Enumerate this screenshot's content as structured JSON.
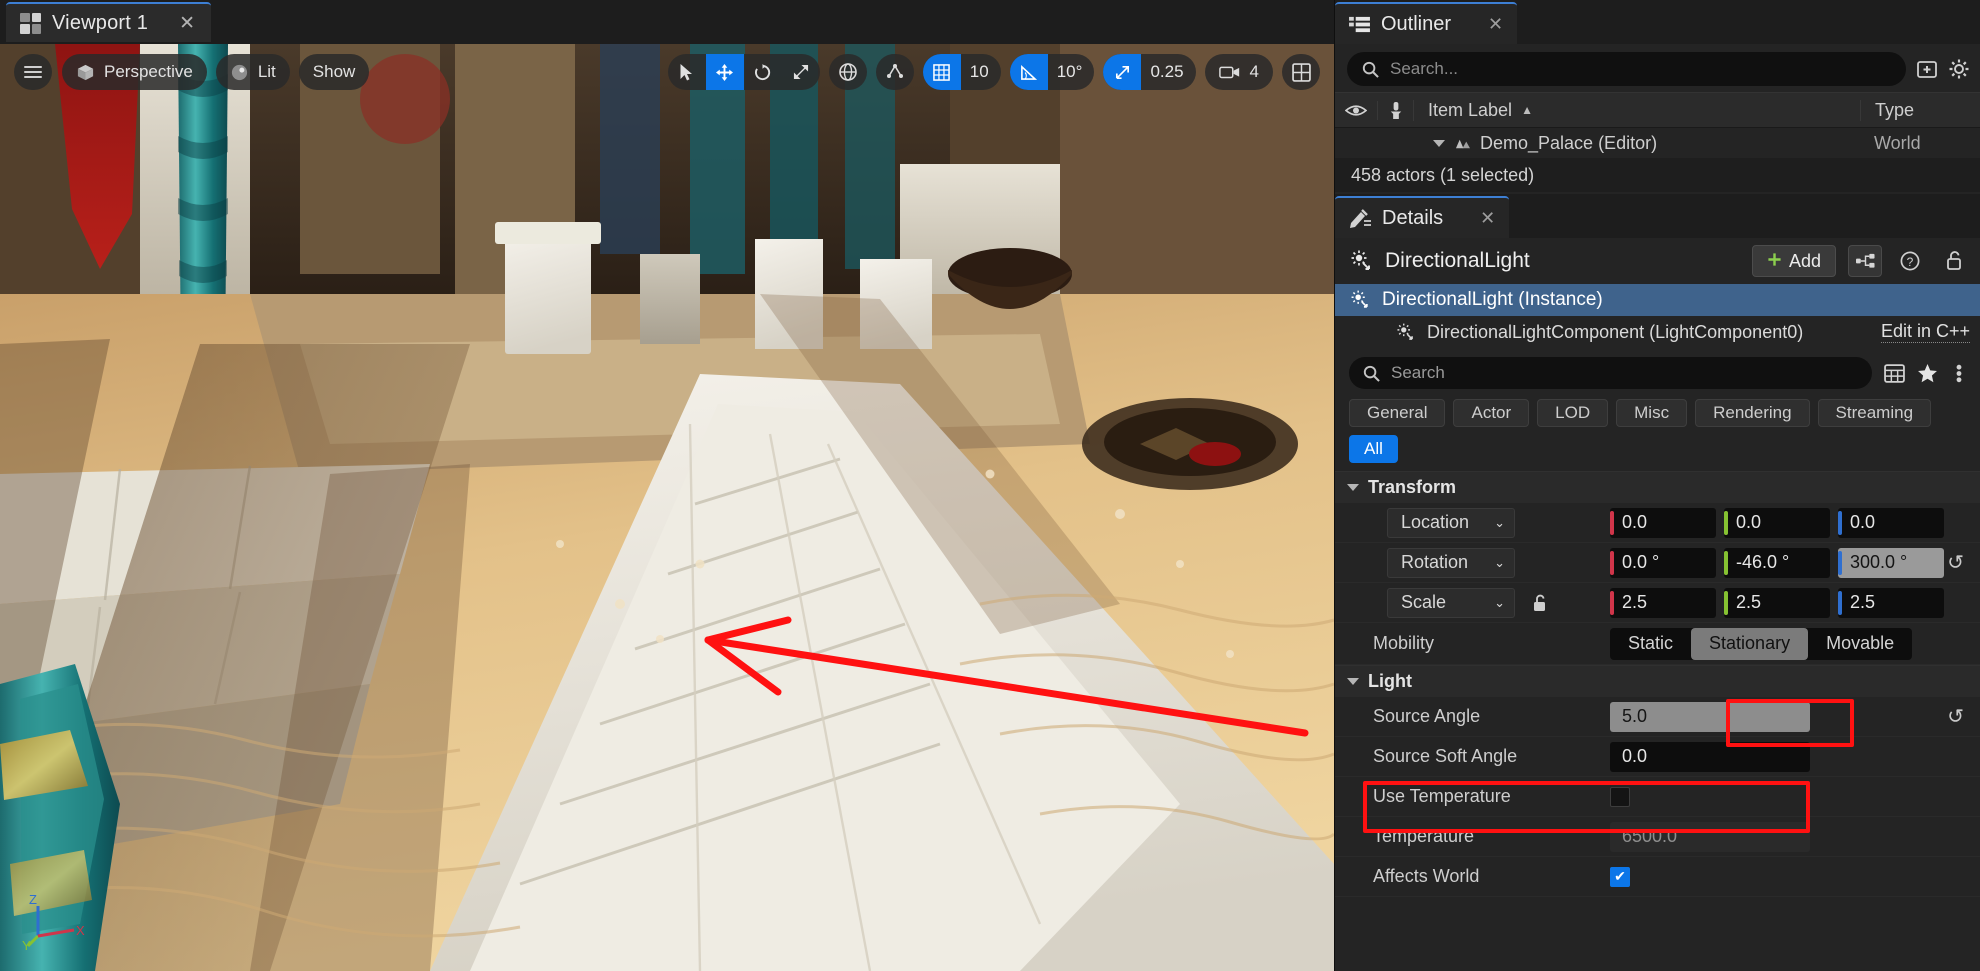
{
  "viewport": {
    "tab_label": "Viewport 1",
    "tab_close": "✕",
    "menu_icon": "hamburger-icon",
    "camera_mode": "Perspective",
    "view_mode": "Lit",
    "show_menu": "Show",
    "transform_tools": [
      "select-icon",
      "move-icon",
      "rotate-icon",
      "scale-icon"
    ],
    "coord_space": "globe-icon",
    "surface_snap": "surface-snap-icon",
    "grid_snap_value": "10",
    "angle_snap_value": "10°",
    "scale_snap_value": "0.25",
    "camera_speed_value": "4",
    "layout_icon": "viewport-layout-icon",
    "axis_labels": [
      "Z",
      "Y",
      "X"
    ]
  },
  "outliner": {
    "tab_label": "Outliner",
    "tab_close": "✕",
    "search_placeholder": "Search...",
    "columns": {
      "label": "Item Label",
      "type": "Type"
    },
    "sort_indicator": "▲",
    "rows": [
      {
        "label": "Demo_Palace (Editor)",
        "type": "World"
      }
    ],
    "status": "458 actors (1 selected)"
  },
  "details": {
    "tab_label": "Details",
    "tab_close": "✕",
    "header_title": "DirectionalLight",
    "header_icon": "directional-light-icon",
    "add_label": "Add",
    "components": [
      {
        "label": "DirectionalLight (Instance)",
        "selected": true
      },
      {
        "label": "DirectionalLightComponent (LightComponent0)",
        "selected": false,
        "link": "Edit in C++"
      }
    ],
    "search_placeholder": "Search",
    "filters": [
      {
        "label": "General",
        "active": false
      },
      {
        "label": "Actor",
        "active": false
      },
      {
        "label": "LOD",
        "active": false
      },
      {
        "label": "Misc",
        "active": false
      },
      {
        "label": "Rendering",
        "active": false
      },
      {
        "label": "Streaming",
        "active": false
      },
      {
        "label": "All",
        "active": true
      }
    ],
    "sections": [
      {
        "title": "Transform"
      },
      {
        "title": "Light"
      }
    ],
    "transform": {
      "location": {
        "label": "Location",
        "x": "0.0",
        "y": "0.0",
        "z": "0.0"
      },
      "rotation": {
        "label": "Rotation",
        "x": "0.0 °",
        "y": "-46.0 °",
        "z": "300.0 °"
      },
      "scale": {
        "label": "Scale",
        "x": "2.5",
        "y": "2.5",
        "z": "2.5"
      },
      "mobility": {
        "label": "Mobility",
        "options": [
          "Static",
          "Stationary",
          "Movable"
        ],
        "selected": "Stationary"
      }
    },
    "light": {
      "source_angle": {
        "label": "Source Angle",
        "value": "5.0"
      },
      "source_soft_angle": {
        "label": "Source Soft Angle",
        "value": "0.0"
      },
      "use_temperature": {
        "label": "Use Temperature",
        "checked": false
      },
      "temperature": {
        "label": "Temperature",
        "value": "6500.0"
      },
      "affects_world": {
        "label": "Affects World",
        "checked": true,
        "check_glyph": "✔"
      }
    },
    "revert_glyph": "↺"
  },
  "colors": {
    "accent_blue": "#0c76e8",
    "selection_blue": "#3f638c",
    "annotation_red": "#ff1111",
    "axis_x": "#d0354a",
    "axis_y": "#86c232",
    "axis_z": "#2f6fd0",
    "add_green": "#8ccf4e"
  }
}
